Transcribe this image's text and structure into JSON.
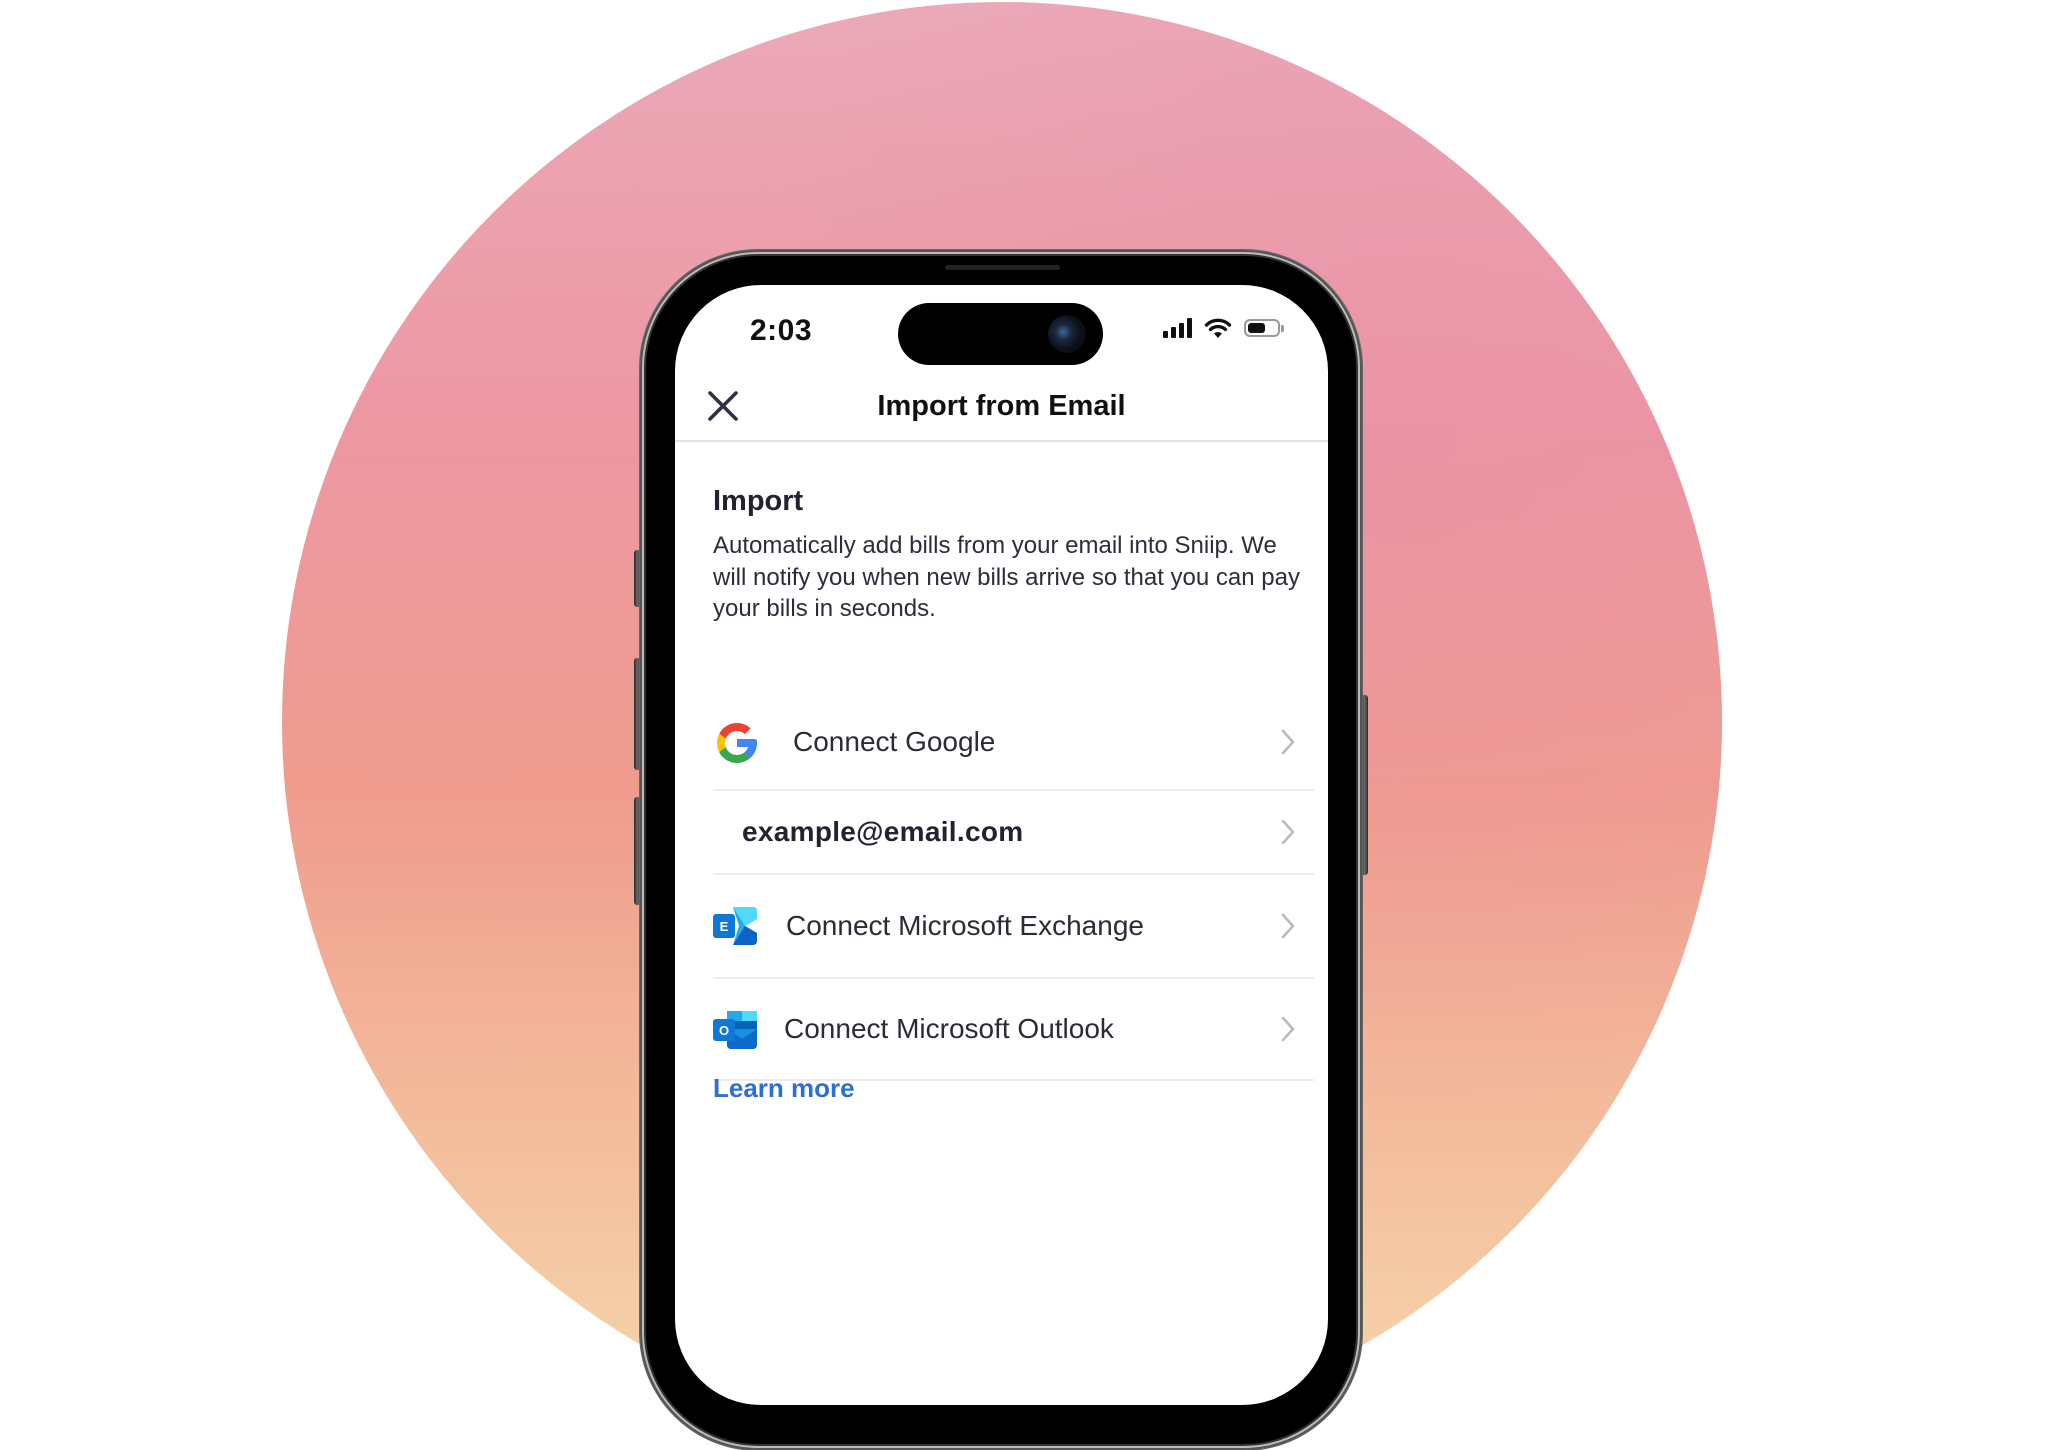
{
  "status_bar": {
    "time": "2:03",
    "signal_bars": 4,
    "wifi": "wifi-icon",
    "battery_level_percent": 60
  },
  "nav": {
    "close_icon": "close-icon",
    "title": "Import from Email"
  },
  "section": {
    "title": "Import",
    "body": "Automatically add bills from your email into Sniip. We will notify you when new bills arrive so that you can pay your bills in seconds."
  },
  "list": [
    {
      "icon": "google-icon",
      "label": "Connect Google"
    },
    {
      "icon": null,
      "label": "example@email.com"
    },
    {
      "icon": "microsoft-exchange-icon",
      "label": "Connect Microsoft Exchange"
    },
    {
      "icon": "microsoft-outlook-icon",
      "label": "Connect Microsoft Outlook"
    }
  ],
  "learn_more": "Learn more",
  "colors": {
    "link": "#2E6FD6",
    "text": "#23232F",
    "divider": "#ECECEE",
    "background_gradient_top": "#EBA9B8",
    "background_gradient_bottom": "#F6D8AB"
  }
}
